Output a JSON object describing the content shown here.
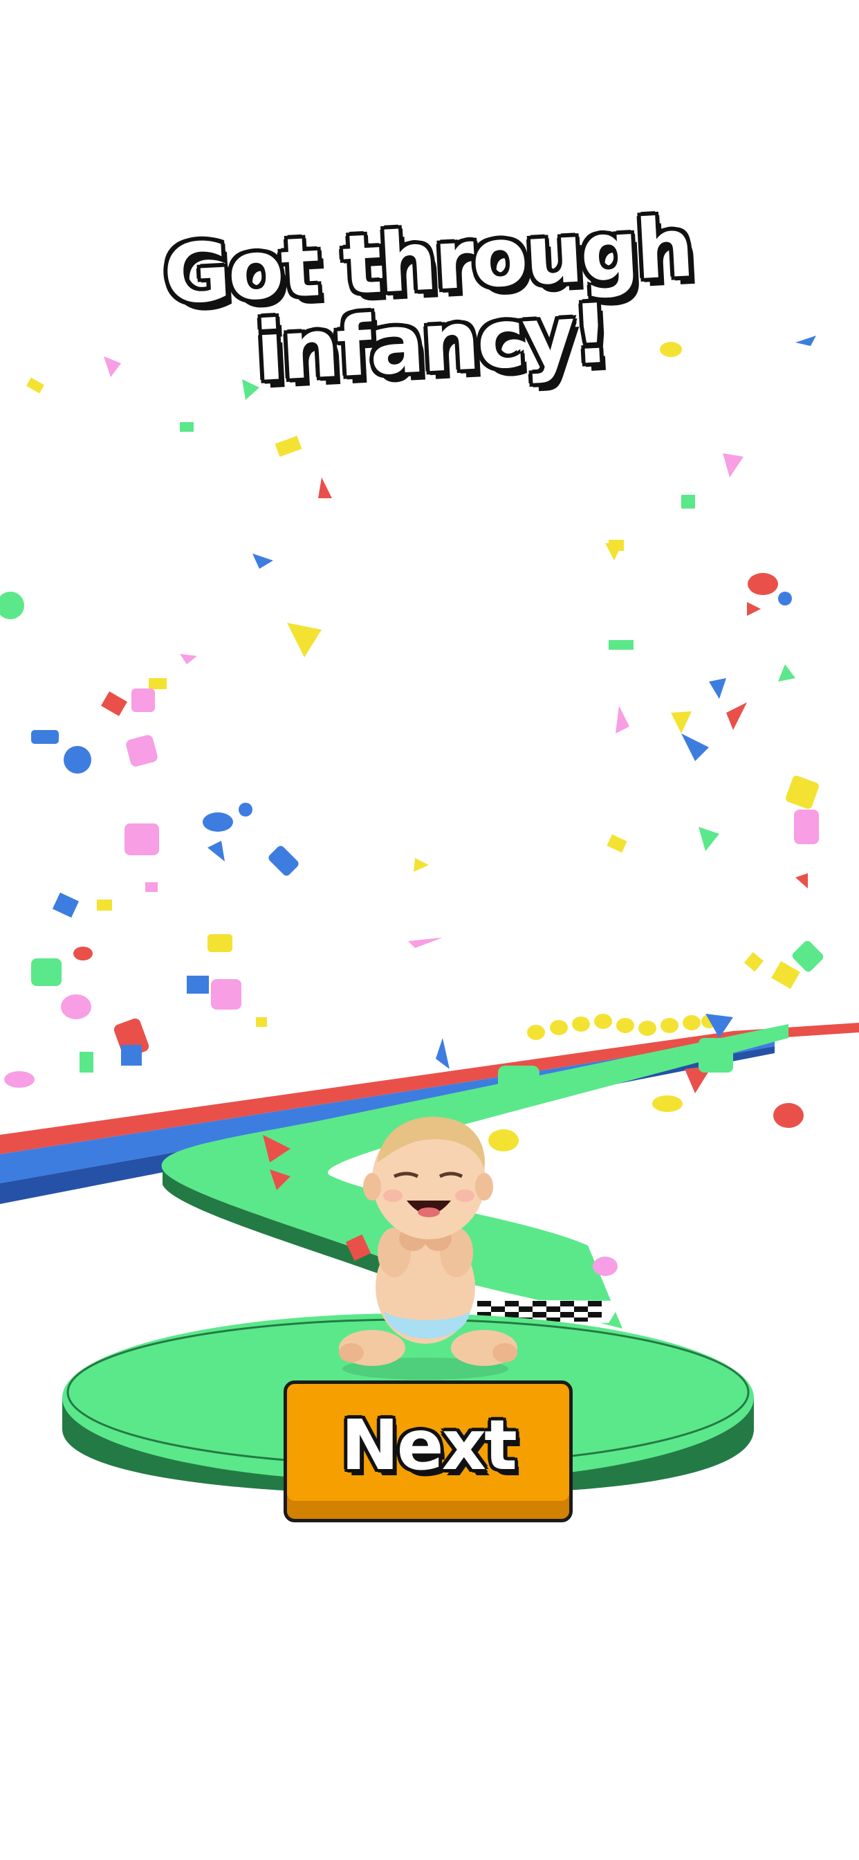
{
  "title": {
    "line1": "Got through",
    "line2": "infancy!"
  },
  "next_button": {
    "label": "Next"
  },
  "colors": {
    "button": "#f5a000",
    "platform": "#5be88a",
    "platform_side": "#247a45",
    "track_red": "#e9504a",
    "track_blue": "#3d7de0"
  },
  "icons": {
    "character": "baby-character-icon",
    "finish_line": "checkered-flag-icon",
    "confetti": "confetti-icon"
  }
}
